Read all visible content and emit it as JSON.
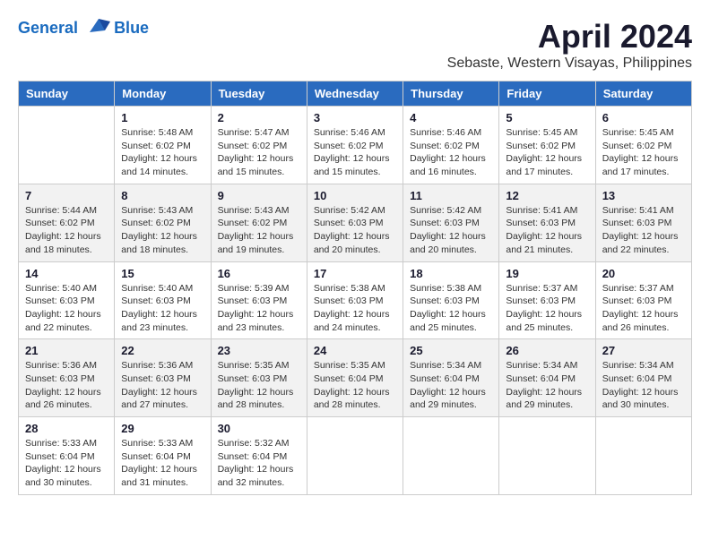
{
  "header": {
    "logo_line1": "General",
    "logo_line2": "Blue",
    "month_title": "April 2024",
    "location": "Sebaste, Western Visayas, Philippines"
  },
  "calendar": {
    "days_of_week": [
      "Sunday",
      "Monday",
      "Tuesday",
      "Wednesday",
      "Thursday",
      "Friday",
      "Saturday"
    ],
    "weeks": [
      [
        {
          "day": "",
          "info": ""
        },
        {
          "day": "1",
          "info": "Sunrise: 5:48 AM\nSunset: 6:02 PM\nDaylight: 12 hours\nand 14 minutes."
        },
        {
          "day": "2",
          "info": "Sunrise: 5:47 AM\nSunset: 6:02 PM\nDaylight: 12 hours\nand 15 minutes."
        },
        {
          "day": "3",
          "info": "Sunrise: 5:46 AM\nSunset: 6:02 PM\nDaylight: 12 hours\nand 15 minutes."
        },
        {
          "day": "4",
          "info": "Sunrise: 5:46 AM\nSunset: 6:02 PM\nDaylight: 12 hours\nand 16 minutes."
        },
        {
          "day": "5",
          "info": "Sunrise: 5:45 AM\nSunset: 6:02 PM\nDaylight: 12 hours\nand 17 minutes."
        },
        {
          "day": "6",
          "info": "Sunrise: 5:45 AM\nSunset: 6:02 PM\nDaylight: 12 hours\nand 17 minutes."
        }
      ],
      [
        {
          "day": "7",
          "info": "Sunrise: 5:44 AM\nSunset: 6:02 PM\nDaylight: 12 hours\nand 18 minutes."
        },
        {
          "day": "8",
          "info": "Sunrise: 5:43 AM\nSunset: 6:02 PM\nDaylight: 12 hours\nand 18 minutes."
        },
        {
          "day": "9",
          "info": "Sunrise: 5:43 AM\nSunset: 6:02 PM\nDaylight: 12 hours\nand 19 minutes."
        },
        {
          "day": "10",
          "info": "Sunrise: 5:42 AM\nSunset: 6:03 PM\nDaylight: 12 hours\nand 20 minutes."
        },
        {
          "day": "11",
          "info": "Sunrise: 5:42 AM\nSunset: 6:03 PM\nDaylight: 12 hours\nand 20 minutes."
        },
        {
          "day": "12",
          "info": "Sunrise: 5:41 AM\nSunset: 6:03 PM\nDaylight: 12 hours\nand 21 minutes."
        },
        {
          "day": "13",
          "info": "Sunrise: 5:41 AM\nSunset: 6:03 PM\nDaylight: 12 hours\nand 22 minutes."
        }
      ],
      [
        {
          "day": "14",
          "info": "Sunrise: 5:40 AM\nSunset: 6:03 PM\nDaylight: 12 hours\nand 22 minutes."
        },
        {
          "day": "15",
          "info": "Sunrise: 5:40 AM\nSunset: 6:03 PM\nDaylight: 12 hours\nand 23 minutes."
        },
        {
          "day": "16",
          "info": "Sunrise: 5:39 AM\nSunset: 6:03 PM\nDaylight: 12 hours\nand 23 minutes."
        },
        {
          "day": "17",
          "info": "Sunrise: 5:38 AM\nSunset: 6:03 PM\nDaylight: 12 hours\nand 24 minutes."
        },
        {
          "day": "18",
          "info": "Sunrise: 5:38 AM\nSunset: 6:03 PM\nDaylight: 12 hours\nand 25 minutes."
        },
        {
          "day": "19",
          "info": "Sunrise: 5:37 AM\nSunset: 6:03 PM\nDaylight: 12 hours\nand 25 minutes."
        },
        {
          "day": "20",
          "info": "Sunrise: 5:37 AM\nSunset: 6:03 PM\nDaylight: 12 hours\nand 26 minutes."
        }
      ],
      [
        {
          "day": "21",
          "info": "Sunrise: 5:36 AM\nSunset: 6:03 PM\nDaylight: 12 hours\nand 26 minutes."
        },
        {
          "day": "22",
          "info": "Sunrise: 5:36 AM\nSunset: 6:03 PM\nDaylight: 12 hours\nand 27 minutes."
        },
        {
          "day": "23",
          "info": "Sunrise: 5:35 AM\nSunset: 6:03 PM\nDaylight: 12 hours\nand 28 minutes."
        },
        {
          "day": "24",
          "info": "Sunrise: 5:35 AM\nSunset: 6:04 PM\nDaylight: 12 hours\nand 28 minutes."
        },
        {
          "day": "25",
          "info": "Sunrise: 5:34 AM\nSunset: 6:04 PM\nDaylight: 12 hours\nand 29 minutes."
        },
        {
          "day": "26",
          "info": "Sunrise: 5:34 AM\nSunset: 6:04 PM\nDaylight: 12 hours\nand 29 minutes."
        },
        {
          "day": "27",
          "info": "Sunrise: 5:34 AM\nSunset: 6:04 PM\nDaylight: 12 hours\nand 30 minutes."
        }
      ],
      [
        {
          "day": "28",
          "info": "Sunrise: 5:33 AM\nSunset: 6:04 PM\nDaylight: 12 hours\nand 30 minutes."
        },
        {
          "day": "29",
          "info": "Sunrise: 5:33 AM\nSunset: 6:04 PM\nDaylight: 12 hours\nand 31 minutes."
        },
        {
          "day": "30",
          "info": "Sunrise: 5:32 AM\nSunset: 6:04 PM\nDaylight: 12 hours\nand 32 minutes."
        },
        {
          "day": "",
          "info": ""
        },
        {
          "day": "",
          "info": ""
        },
        {
          "day": "",
          "info": ""
        },
        {
          "day": "",
          "info": ""
        }
      ]
    ]
  }
}
